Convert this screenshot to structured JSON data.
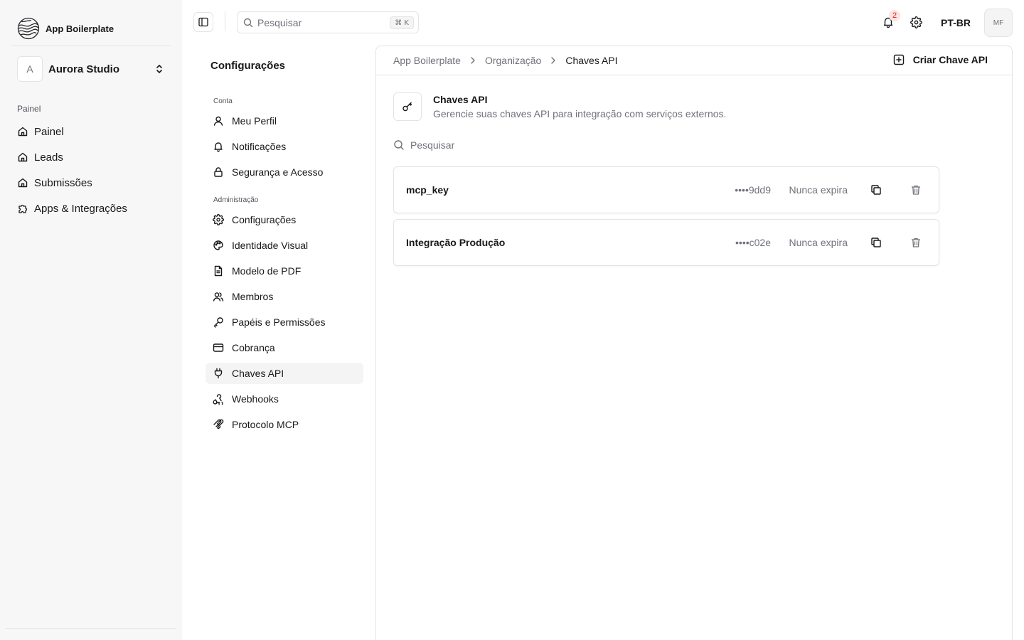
{
  "brand": {
    "name": "App Boilerplate"
  },
  "org": {
    "initial": "A",
    "name": "Aurora Studio"
  },
  "sidebar": {
    "group_label": "Painel",
    "items": [
      {
        "label": "Painel",
        "icon": "home-icon"
      },
      {
        "label": "Leads",
        "icon": "home-icon"
      },
      {
        "label": "Submissões",
        "icon": "home-icon"
      },
      {
        "label": "Apps & Integrações",
        "icon": "puzzle-icon"
      }
    ]
  },
  "topbar": {
    "search_placeholder": "Pesquisar",
    "shortcut": "⌘ K",
    "notification_count": "2",
    "language": "PT-BR",
    "user_initials": "MF"
  },
  "settings_nav": {
    "title": "Configurações",
    "groups": [
      {
        "label": "Conta",
        "items": [
          {
            "label": "Meu Perfil",
            "icon": "user-icon"
          },
          {
            "label": "Notificações",
            "icon": "bell-icon"
          },
          {
            "label": "Segurança e Acesso",
            "icon": "lock-icon"
          }
        ]
      },
      {
        "label": "Administração",
        "items": [
          {
            "label": "Configurações",
            "icon": "gear-icon"
          },
          {
            "label": "Identidade Visual",
            "icon": "palette-icon"
          },
          {
            "label": "Modelo de PDF",
            "icon": "file-icon"
          },
          {
            "label": "Membros",
            "icon": "users-icon"
          },
          {
            "label": "Papéis e Permissões",
            "icon": "key-icon"
          },
          {
            "label": "Cobrança",
            "icon": "credit-card-icon"
          },
          {
            "label": "Chaves API",
            "icon": "plug-icon",
            "active": true
          },
          {
            "label": "Webhooks",
            "icon": "webhook-icon"
          },
          {
            "label": "Protocolo MCP",
            "icon": "mcp-icon"
          }
        ]
      }
    ]
  },
  "breadcrumb": {
    "items": [
      "App Boilerplate",
      "Organização",
      "Chaves API"
    ]
  },
  "actions": {
    "create_label": "Criar Chave API"
  },
  "page": {
    "title": "Chaves API",
    "subtitle": "Gerencie suas chaves API para integração com serviços externos.",
    "search_placeholder": "Pesquisar"
  },
  "keys": [
    {
      "name": "mcp_key",
      "masked": "••••9dd9",
      "expiry": "Nunca expira"
    },
    {
      "name": "Integração Produção",
      "masked": "••••c02e",
      "expiry": "Nunca expira"
    }
  ]
}
